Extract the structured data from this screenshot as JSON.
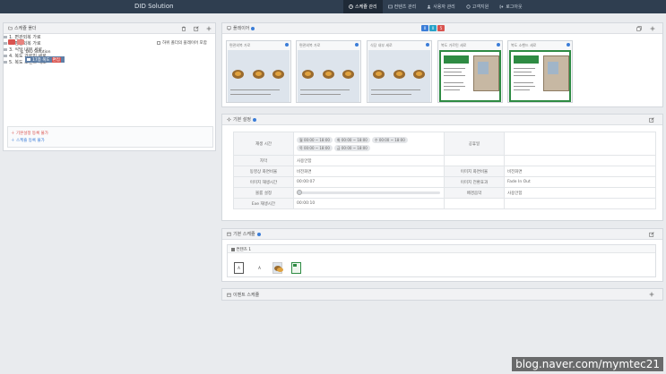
{
  "app": {
    "brand": "DID Solution"
  },
  "nav": [
    {
      "label": "스케쥴 관리",
      "icon": "clock-icon",
      "active": true
    },
    {
      "label": "컨텐츠 관리",
      "icon": "image-icon",
      "active": false
    },
    {
      "label": "사용자 관리",
      "icon": "user-icon",
      "active": false
    },
    {
      "label": "고객지원",
      "icon": "support-icon",
      "active": false
    },
    {
      "label": "로그아웃",
      "icon": "logout-icon",
      "active": false
    }
  ],
  "schedule_folder": {
    "title": "스케쥴 폴더",
    "show_subfolder_players": "하위 폴더의 플레이어 포함",
    "root": "DID Solution",
    "group": "17층 복도",
    "group_badge": "편집",
    "items": [
      "1. 편관외복 가로",
      "2. 편관외복 가로",
      "3. 식당 내부 세로",
      "4. 복도 가르민 세로",
      "5. 복도 소핸드 세로"
    ],
    "links": [
      "기본설정 등록 불가",
      "스케쥴 등록 불가"
    ]
  },
  "player": {
    "title": "플레이어",
    "badges": [
      {
        "value": "0",
        "color": "#3b7dd8"
      },
      {
        "value": "0",
        "color": "#29a3c9"
      },
      {
        "value": "5",
        "color": "#d9534f"
      }
    ],
    "thumbnails": [
      {
        "label": "편관외복 가로",
        "kind": "food"
      },
      {
        "label": "편관외복 가로",
        "kind": "food"
      },
      {
        "label": "식당 내부 세로",
        "kind": "food"
      },
      {
        "label": "복도 가르민 세로",
        "kind": "map"
      },
      {
        "label": "복도 소핸드 세로",
        "kind": "map"
      }
    ]
  },
  "basic_settings": {
    "title": "기본 설정",
    "rows": {
      "play_time_label": "재생 시간",
      "days": [
        {
          "day": "월",
          "range": "00:00 ~ 18:00"
        },
        {
          "day": "화",
          "range": "00:00 ~ 18:00"
        },
        {
          "day": "수",
          "range": "00:00 ~ 18:00"
        },
        {
          "day": "목",
          "range": "00:00 ~ 18:00"
        },
        {
          "day": "금",
          "range": "00:00 ~ 18:00"
        }
      ],
      "holiday_label": "공휴일",
      "subtitle_label": "자막",
      "subtitle_value": "사용안함",
      "video_ratio_label": "동영상 화면비율",
      "video_ratio_value": "비전화면",
      "image_ratio_label": "이미지 화면비율",
      "image_ratio_value": "비전화면",
      "image_time_label": "이미지 재생시간",
      "image_time_value": "00:00:07",
      "image_transition_label": "이미지 전환효과",
      "image_transition_value": "Fade In Out",
      "volume_label": "볼륨 설정",
      "bgm_label": "배경음악",
      "bgm_value": "사용안함",
      "exe_time_label": "Exe 재생시간",
      "exe_time_value": "00:00:10"
    }
  },
  "basic_schedule": {
    "title": "기본 스케쥴",
    "group_label": "컨텐츠 1",
    "tile_a": "A",
    "tile_a2": "A"
  },
  "event_schedule": {
    "title": "이벤트 스케쥴"
  },
  "watermark": "blog.naver.com/mymtec21"
}
